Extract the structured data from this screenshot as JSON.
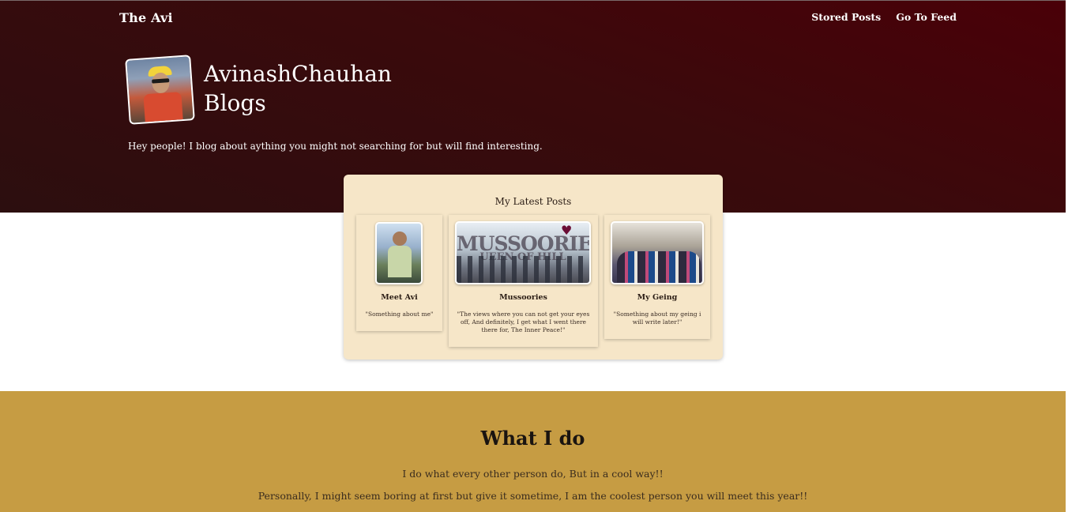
{
  "nav": {
    "brand": "The Avi",
    "links": [
      "Stored Posts",
      "Go To Feed"
    ]
  },
  "hero": {
    "title_line1": "AvinashChauhan",
    "title_line2": "Blogs",
    "description": "Hey people! I blog about aything you might not searching for but will find interesting."
  },
  "latest": {
    "title": "My Latest Posts",
    "posts": [
      {
        "title": "Meet Avi",
        "description": "\"Something about me\""
      },
      {
        "title": "Mussoories",
        "description": "\"The views where you can not get your eyes off, And definitely, I get what I went there there for, The Inner Peace!\"",
        "image_text": "MUSSOORIE",
        "image_subtext": "UEEN OF HILL"
      },
      {
        "title": "My Geing",
        "description": "\"Something about my geing i will write later!\""
      }
    ]
  },
  "whatido": {
    "heading": "What I do",
    "para1": "I do what every other person do, But in a cool way!!",
    "para2": "Personally, I might seem boring at first but give it sometime, I am the coolest person you will meet this year!!"
  },
  "colors": {
    "hero_bg": "#3a0a0c",
    "card_bg": "#f6e6c8",
    "section_bg": "#c69c43"
  }
}
